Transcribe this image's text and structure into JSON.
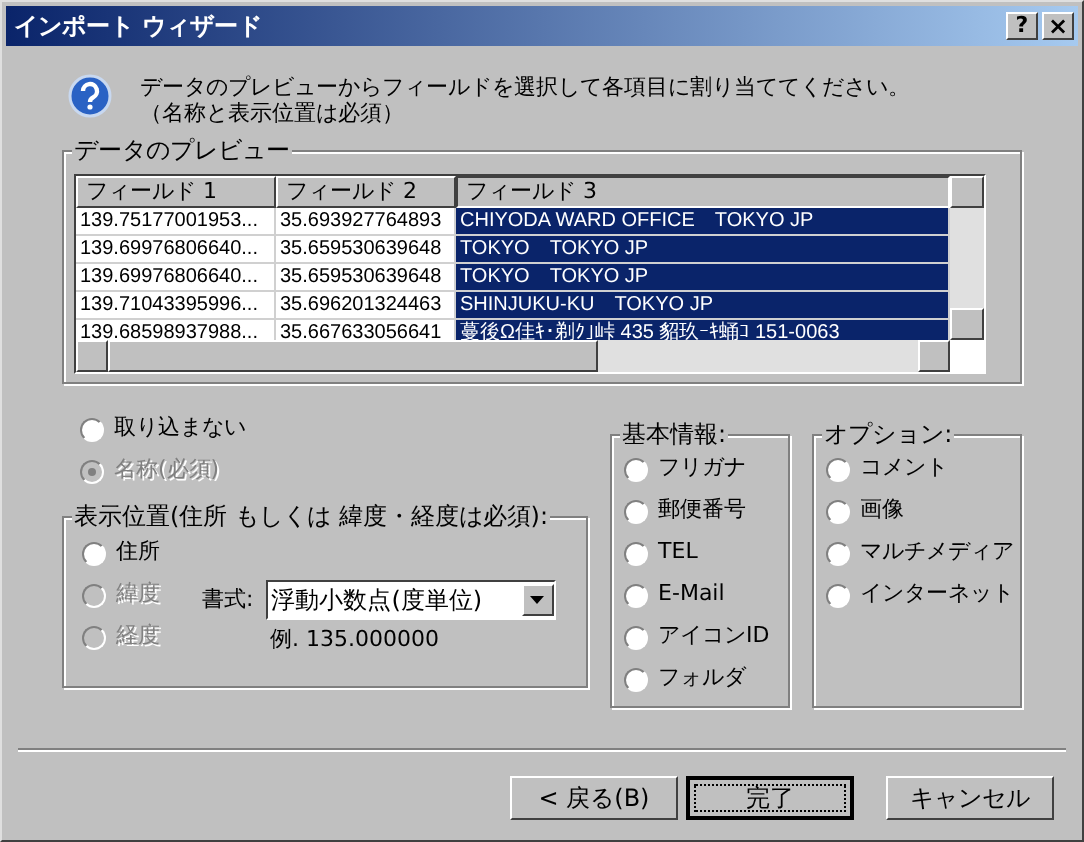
{
  "window": {
    "title": "インポート ウィザード",
    "help_button": "?",
    "close_button": "×"
  },
  "instruction": [
    "データのプレビューからフィールドを選択して各項目に割り当ててください。",
    "（名称と表示位置は必須）"
  ],
  "preview": {
    "title": "データのプレビュー",
    "columns": [
      {
        "label": "フィールド 1",
        "selected": false
      },
      {
        "label": "フィールド 2",
        "selected": false
      },
      {
        "label": "フィールド 3",
        "selected": true
      }
    ],
    "rows": [
      [
        "139.75177001953...",
        "35.693927764893",
        "CHIYODA WARD OFFICE　TOKYO  JP"
      ],
      [
        "139.69976806640...",
        "35.659530639648",
        "TOKYO　TOKYO  JP"
      ],
      [
        "139.69976806640...",
        "35.659530639648",
        "TOKYO　TOKYO  JP"
      ],
      [
        "139.71043395996...",
        "35.696201324463",
        "SHINJUKU-KU　TOKYO  JP"
      ],
      [
        "139.68598937988...",
        "35.667633056641",
        "蔓後Ω佳ｷ･剃ｸ｣峠 435  貂玖ｰｷ蛹ｺ  151-0063"
      ]
    ]
  },
  "top_options": [
    {
      "label": "取り込まない",
      "selected": false,
      "disabled": false
    },
    {
      "label": "名称(必須)",
      "selected": true,
      "disabled": true
    }
  ],
  "location": {
    "title": "表示位置(住所 もしくは 緯度・経度は必須):",
    "options": [
      {
        "label": "住所",
        "selected": false,
        "disabled": false
      },
      {
        "label": "緯度",
        "selected": false,
        "disabled": true
      },
      {
        "label": "経度",
        "selected": false,
        "disabled": true
      }
    ],
    "format_label": "書式:",
    "format_value": "浮動小数点(度単位)",
    "example": "例. 135.000000"
  },
  "basic": {
    "title": "基本情報:",
    "options": [
      {
        "label": "フリガナ",
        "selected": false
      },
      {
        "label": "郵便番号",
        "selected": false
      },
      {
        "label": "TEL",
        "selected": false
      },
      {
        "label": "E-Mail",
        "selected": false
      },
      {
        "label": "アイコンID",
        "selected": false
      },
      {
        "label": "フォルダ",
        "selected": false
      }
    ]
  },
  "option_group": {
    "title": "オプション:",
    "options": [
      {
        "label": "コメント",
        "selected": false
      },
      {
        "label": "画像",
        "selected": false
      },
      {
        "label": "マルチメディア",
        "selected": false
      },
      {
        "label": "インターネット",
        "selected": false
      }
    ]
  },
  "buttons": [
    {
      "label": "< 戻る(B)",
      "default": false
    },
    {
      "label": "完了",
      "default": true
    },
    {
      "label": "キャンセル",
      "default": false
    }
  ]
}
